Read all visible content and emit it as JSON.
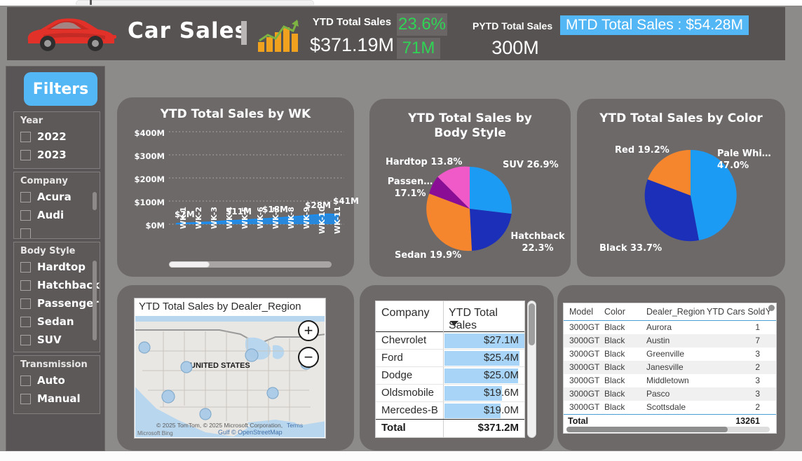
{
  "header": {
    "app_title": "Car Sales",
    "car_icon": "car-icon",
    "bar_chart_icon": "bar-chart-icon",
    "kpi_ytd_label": "YTD Total Sales",
    "kpi_ytd_value": "$371.19M",
    "kpi_growth_pct": "23.6%",
    "kpi_growth_sub": "71M",
    "kpi_pytd_label": "PYTD Total Sales",
    "kpi_pytd_value": "300M",
    "kpi_mtd": "MTD Total Sales : $54.28M",
    "accent_blue": "#53b6f5",
    "accent_green": "#2fd455"
  },
  "filters": {
    "button_label": "Filters",
    "slicers": [
      {
        "title": "Year",
        "items": [
          "2022",
          "2023"
        ],
        "has_scroll": false
      },
      {
        "title": "Company",
        "items": [
          "Acura",
          "Audi"
        ],
        "has_scroll": true
      },
      {
        "title": "Body Style",
        "items": [
          "Hardtop",
          "Hatchback",
          "Passenger",
          "Sedan",
          "SUV"
        ],
        "has_scroll": true
      },
      {
        "title": "Transmission",
        "items": [
          "Auto",
          "Manual"
        ],
        "has_scroll": false
      }
    ]
  },
  "line_card": {
    "title": "YTD Total Sales by WK"
  },
  "pie_body_card": {
    "title": "YTD Total Sales by Body Style"
  },
  "pie_color_card": {
    "title": "YTD Total Sales by Color"
  },
  "map": {
    "title": "YTD Total Sales by Dealer_Region",
    "country_label": "UNITED STATES",
    "attribution": "© 2025 TomTom, © 2025 Microsoft Corporation,",
    "terms_label": "Terms",
    "attribution2": "Gulf © OpenStreetMap",
    "bing_label": "Microsoft Bing",
    "zoom_in_icon": "plus-icon",
    "zoom_out_icon": "minus-icon"
  },
  "company_table": {
    "columns": [
      "Company",
      "YTD Total Sales"
    ],
    "rows": [
      {
        "company": "Chevrolet",
        "sales": "$27.1M",
        "bar_pct": 100
      },
      {
        "company": "Ford",
        "sales": "$25.4M",
        "bar_pct": 94
      },
      {
        "company": "Dodge",
        "sales": "$25.0M",
        "bar_pct": 92
      },
      {
        "company": "Oldsmobile",
        "sales": "$19.6M",
        "bar_pct": 72
      },
      {
        "company": "Mercedes-B",
        "sales": "$19.0M",
        "bar_pct": 70
      }
    ],
    "total_label": "Total",
    "total_value": "$371.2M"
  },
  "detail_table": {
    "columns": [
      "Model",
      "Color",
      "Dealer_Region",
      "YTD Cars Sold",
      "Y"
    ],
    "rows": [
      {
        "model": "3000GT",
        "color": "Black",
        "region": "Aurora",
        "sold": "1"
      },
      {
        "model": "3000GT",
        "color": "Black",
        "region": "Austin",
        "sold": "7"
      },
      {
        "model": "3000GT",
        "color": "Black",
        "region": "Greenville",
        "sold": "3"
      },
      {
        "model": "3000GT",
        "color": "Black",
        "region": "Janesville",
        "sold": "2"
      },
      {
        "model": "3000GT",
        "color": "Black",
        "region": "Middletown",
        "sold": "3"
      },
      {
        "model": "3000GT",
        "color": "Black",
        "region": "Pasco",
        "sold": "3"
      },
      {
        "model": "3000GT",
        "color": "Black",
        "region": "Scottsdale",
        "sold": "2"
      }
    ],
    "total_label": "Total",
    "total_value": "13261"
  },
  "chart_data": [
    {
      "type": "area",
      "title": "YTD Total Sales by WK",
      "xlabel": "",
      "ylabel": "",
      "categories": [
        "WK-1",
        "WK-2",
        "WK-3",
        "WK-4",
        "WK-5",
        "WK-6",
        "WK-7",
        "WK-8",
        "WK-9",
        "WK-10",
        "WK-11"
      ],
      "values": [
        2,
        5,
        8,
        11,
        14,
        18,
        22,
        25,
        28,
        34,
        41
      ],
      "value_unit": "M",
      "data_labels": [
        "$2M",
        "",
        "",
        "$11M",
        "",
        "$18M",
        "",
        "$28M",
        "",
        "",
        "$41M"
      ],
      "ytick_labels": [
        "$0M",
        "$100M",
        "$200M",
        "$300M",
        "$400M"
      ],
      "ylim": [
        0,
        400
      ],
      "grid": true,
      "series_color": "#1c8ef0",
      "legend": "none"
    },
    {
      "type": "pie",
      "title": "YTD Total Sales by Body Style",
      "labels": [
        "SUV",
        "Hatchback",
        "Sedan",
        "Passenger",
        "Hardtop"
      ],
      "display_labels": [
        "SUV 26.9%",
        "Hatchback 22.3%",
        "Sedan 19.9%",
        "Passen… 17.1%",
        "Hardtop 13.8%"
      ],
      "values": [
        26.9,
        22.3,
        19.9,
        17.1,
        13.8
      ],
      "colors": [
        "#1c9bf5",
        "#1b2fb8",
        "#f5862e",
        "#8a0d95",
        "#ef5ac8"
      ],
      "legend": "none"
    },
    {
      "type": "pie",
      "title": "YTD Total Sales by Color",
      "labels": [
        "Pale White",
        "Black",
        "Red"
      ],
      "display_labels": [
        "Pale Whi… 47.0%",
        "Black 33.7%",
        "Red 19.2%"
      ],
      "values": [
        47.0,
        33.7,
        19.2
      ],
      "colors": [
        "#1c9bf5",
        "#1b2fb8",
        "#f5862e"
      ],
      "legend": "none"
    }
  ]
}
